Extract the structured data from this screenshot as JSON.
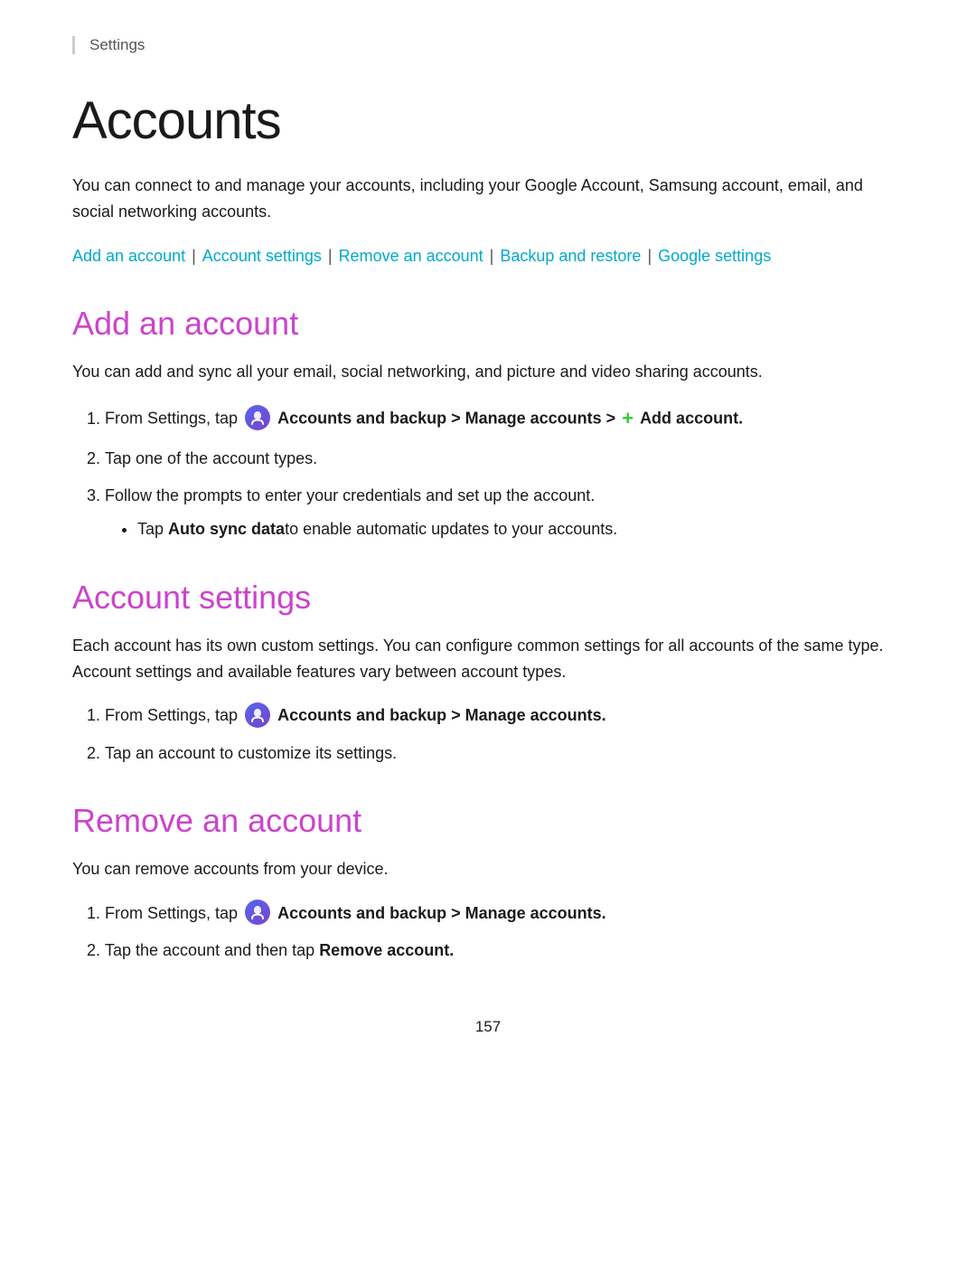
{
  "breadcrumb": {
    "text": "Settings"
  },
  "page": {
    "title": "Accounts",
    "intro": "You can connect to and manage your accounts, including your Google Account, Samsung account, email, and social networking accounts.",
    "page_number": "157"
  },
  "nav_links": {
    "link1": "Add an account",
    "sep1": " | ",
    "link2": "Account settings",
    "sep2": " | ",
    "link3": "Remove an account",
    "sep3": " | ",
    "link4": "Backup and restore",
    "sep4": " | ",
    "link5": "Google settings"
  },
  "section_add": {
    "title": "Add an account",
    "intro": "You can add and sync all your email, social networking, and picture and video sharing accounts.",
    "steps": [
      {
        "id": 1,
        "text_before": "From Settings, tap",
        "icon": "accounts-icon",
        "bold_text": "Accounts and backup > Manage accounts >",
        "plus_icon": "+",
        "bold_text2": "Add account."
      },
      {
        "id": 2,
        "text": "Tap one of the account types."
      },
      {
        "id": 3,
        "text": "Follow the prompts to enter your credentials and set up the account."
      }
    ],
    "bullet": {
      "text_before": "Tap",
      "bold": "Auto sync data",
      "text_after": "to enable automatic updates to your accounts."
    }
  },
  "section_settings": {
    "title": "Account settings",
    "intro": "Each account has its own custom settings. You can configure common settings for all accounts of the same type. Account settings and available features vary between account types.",
    "steps": [
      {
        "id": 1,
        "text_before": "From Settings, tap",
        "icon": "accounts-icon",
        "bold_text": "Accounts and backup > Manage accounts."
      },
      {
        "id": 2,
        "text": "Tap an account to customize its settings."
      }
    ]
  },
  "section_remove": {
    "title": "Remove an account",
    "intro": "You can remove accounts from your device.",
    "steps": [
      {
        "id": 1,
        "text_before": "From Settings, tap",
        "icon": "accounts-icon",
        "bold_text": "Accounts and backup > Manage accounts."
      },
      {
        "id": 2,
        "text_before": "Tap the account and then tap",
        "bold": "Remove account."
      }
    ]
  }
}
